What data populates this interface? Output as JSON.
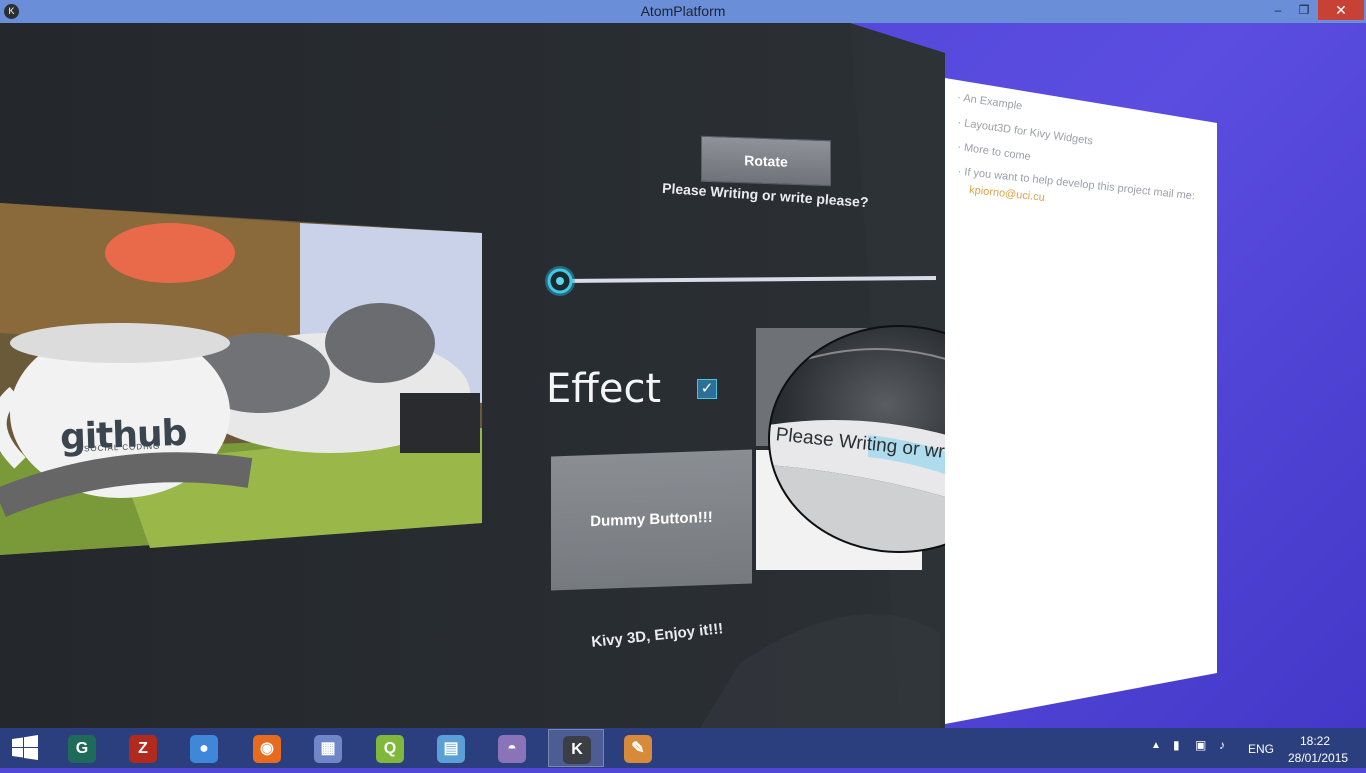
{
  "window": {
    "title": "AtomPlatform",
    "minimize_icon": "minimize-icon",
    "restore_icon": "restore-icon",
    "close_icon": "close-icon"
  },
  "app": {
    "rotate_label": "Rotate",
    "please_text": "Please Writing or write please?",
    "slider_value": 0.0,
    "effect_label": "Effect",
    "effect_checked": true,
    "dummy_label": "Dummy Button!!!",
    "sphere_text": "Please Writing or write please?",
    "footer_text": "Kivy 3D, Enjoy it!!!",
    "mug_brand": "github",
    "mug_tagline": "SOCIAL CODING"
  },
  "document": {
    "items": [
      "An Example",
      "Layout3D for Kivy Widgets",
      "More to come",
      "If you want to help develop this project mail me:"
    ],
    "email": "kpiorno@uci.cu"
  },
  "taskbar": {
    "apps": [
      {
        "name": "terminal-app",
        "icon": "terminal-icon",
        "color": "#1f6b5a",
        "glyph": "G"
      },
      {
        "name": "filezilla-app",
        "icon": "filezilla-icon",
        "color": "#b12a1e",
        "glyph": "Z"
      },
      {
        "name": "chrome-app",
        "icon": "chrome-icon",
        "color": "#3f87d8",
        "glyph": "●"
      },
      {
        "name": "firefox-app",
        "icon": "firefox-icon",
        "color": "#e66b1c",
        "glyph": "◉"
      },
      {
        "name": "disk-app",
        "icon": "disk-icon",
        "color": "#6f86c8",
        "glyph": "▦"
      },
      {
        "name": "qtcreator-app",
        "icon": "qt-icon",
        "color": "#7fb83a",
        "glyph": "Q"
      },
      {
        "name": "control-panel-app",
        "icon": "control-panel-icon",
        "color": "#5aa0d6",
        "glyph": "▤"
      },
      {
        "name": "pidgin-app",
        "icon": "pidgin-icon",
        "color": "#8a73b8",
        "glyph": "◓"
      },
      {
        "name": "kivy-app",
        "icon": "kivy-icon",
        "color": "#3b3f45",
        "glyph": "K"
      },
      {
        "name": "paint-app",
        "icon": "paint-icon",
        "color": "#d68a3a",
        "glyph": "✎"
      }
    ],
    "active_index": 8,
    "lang": "ENG",
    "time": "18:22",
    "date": "28/01/2015"
  }
}
